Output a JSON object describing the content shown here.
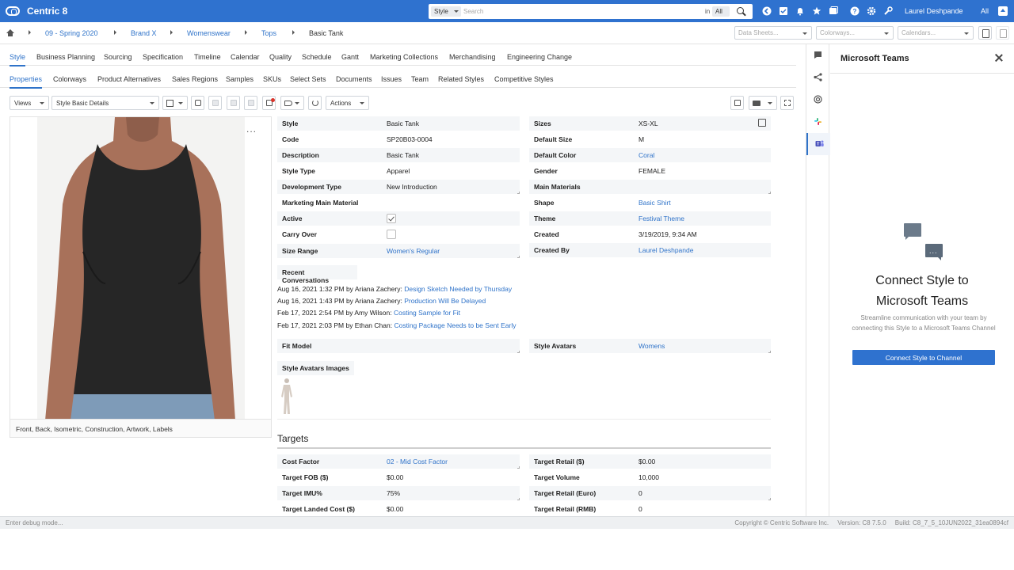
{
  "topbar": {
    "app_title": "Centric 8",
    "search_type": "Style",
    "search_placeholder": "Search",
    "search_in": "in",
    "search_scope": "All",
    "user_name": "Laurel Deshpande",
    "user_scope": "All"
  },
  "breadcrumb": [
    "09 - Spring 2020",
    "Brand X",
    "Womenswear",
    "Tops",
    "Basic Tank"
  ],
  "header_selects": {
    "data_sheets": "Data Sheets...",
    "colorways": "Colorways...",
    "calendars": "Calendars..."
  },
  "tabs_primary": [
    "Style",
    "Business Planning",
    "Sourcing",
    "Specification",
    "Timeline",
    "Calendar",
    "Quality",
    "Schedule",
    "Gantt",
    "Marketing Collections",
    "Merchandising",
    "Engineering Change"
  ],
  "tabs_secondary": [
    "Properties",
    "Colorways",
    "Product Alternatives",
    "Sales Regions",
    "Samples",
    "SKUs",
    "Select Sets",
    "Documents",
    "Issues",
    "Team",
    "Related Styles",
    "Competitive Styles"
  ],
  "toolbar": {
    "views_label": "Views",
    "view_select": "Style Basic Details",
    "actions_label": "Actions"
  },
  "image_panel": {
    "caption": "Front, Back, Isometric, Construction, Artwork, Labels",
    "more": "..."
  },
  "properties_left": [
    {
      "label": "Style",
      "value": "Basic Tank"
    },
    {
      "label": "Code",
      "value": "SP20B03-0004"
    },
    {
      "label": "Description",
      "value": "Basic Tank"
    },
    {
      "label": "Style Type",
      "value": "Apparel"
    },
    {
      "label": "Development Type",
      "value": "New Introduction"
    },
    {
      "label": "Marketing Main Material",
      "value": ""
    },
    {
      "label": "Active",
      "value": ""
    },
    {
      "label": "Carry Over",
      "value": ""
    },
    {
      "label": "Size Range",
      "value": "Women's Regular"
    }
  ],
  "properties_right": [
    {
      "label": "Sizes",
      "value": "XS-XL"
    },
    {
      "label": "Default Size",
      "value": "M"
    },
    {
      "label": "Default Color",
      "value": "Coral"
    },
    {
      "label": "Gender",
      "value": "FEMALE"
    },
    {
      "label": "Main Materials",
      "value": ""
    },
    {
      "label": "Shape",
      "value": "Basic Shirt"
    },
    {
      "label": "Theme",
      "value": "Festival Theme"
    },
    {
      "label": "Created",
      "value": "3/19/2019, 9:34 AM"
    },
    {
      "label": "Created By",
      "value": "Laurel Deshpande"
    }
  ],
  "conversations": {
    "title": "Recent Conversations",
    "items": [
      {
        "meta": "Aug 16, 2021 1:32 PM by Ariana Zachery:",
        "topic": "Design Sketch Needed by Thursday"
      },
      {
        "meta": "Aug 16, 2021 1:43 PM by Ariana Zachery:",
        "topic": "Production Will Be Delayed"
      },
      {
        "meta": "Feb 17, 2021 2:54 PM by Amy Wilson:",
        "topic": "Costing Sample for Fit"
      },
      {
        "meta": "Feb 17, 2021 2:03 PM by Ethan Chan:",
        "topic": "Costing Package Needs to be Sent Early"
      }
    ]
  },
  "fit": {
    "fit_model_label": "Fit Model",
    "fit_model_value": "",
    "style_avatars_label": "Style Avatars",
    "style_avatars_value": "Womens",
    "avatar_images_label": "Style Avatars Images"
  },
  "targets": {
    "title": "Targets",
    "left": [
      {
        "label": "Cost Factor",
        "value": "02 - Mid Cost Factor"
      },
      {
        "label": "Target FOB ($)",
        "value": "$0.00"
      },
      {
        "label": "Target IMU%",
        "value": "75%"
      },
      {
        "label": "Target Landed Cost ($)",
        "value": "$0.00"
      }
    ],
    "right": [
      {
        "label": "Target Retail ($)",
        "value": "$0.00"
      },
      {
        "label": "Target Volume",
        "value": "10,000"
      },
      {
        "label": "Target Retail (Euro)",
        "value": "0"
      },
      {
        "label": "Target Retail (RMB)",
        "value": "0"
      }
    ]
  },
  "teams_panel": {
    "title": "Microsoft Teams",
    "heading_line1": "Connect Style to",
    "heading_line2": "Microsoft Teams",
    "description": "Streamline communication with your team by connecting this Style to a Microsoft Teams Channel",
    "button_label": "Connect Style to Channel",
    "bubble_dots": "..."
  },
  "footer": {
    "debug": "Enter debug mode...",
    "copyright": "Copyright © Centric Software Inc.",
    "version": "Version: C8 7.5.0",
    "build": "Build: C8_7_5_10JUN2022_31ea0894cf"
  },
  "colors": {
    "brand_blue": "#2f72cf",
    "link_blue": "#2f73c9"
  }
}
